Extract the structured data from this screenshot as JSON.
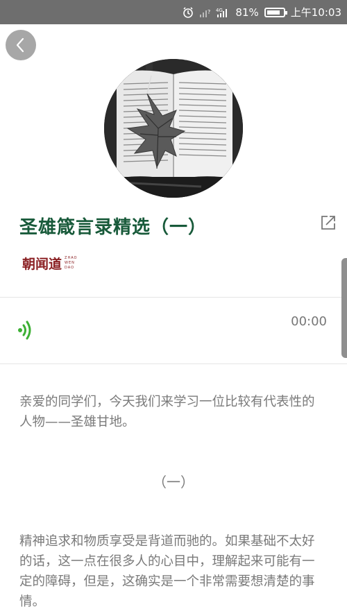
{
  "status_bar": {
    "battery": "81%",
    "battery_level": 0.81,
    "network": "4G",
    "time": "上午10:03"
  },
  "header": {
    "back_icon": "chevron-left-icon"
  },
  "article": {
    "title": "圣雄箴言录精选（一）",
    "share_icon": "share-external-icon",
    "brand": {
      "name": "朝闻道",
      "small_lines": [
        "ZHAO",
        "WEN",
        "DAO"
      ]
    },
    "player": {
      "time": "00:00",
      "icon": "audio-wave-icon",
      "accent": "#3cb034"
    },
    "intro": "亲爱的同学们，今天我们来学习一位比较有代表性的人物——圣雄甘地。",
    "section_heading": "（一）",
    "body": "精神追求和物质享受是背道而驰的。如果基础不太好的话，这一点在很多人的心目中，理解起来可能有一定的障碍，但是，这确实是一个非常需要想清楚的事情。"
  },
  "colors": {
    "title": "#185a3a",
    "brand": "#8a1f22",
    "text": "#7a7a7a"
  }
}
